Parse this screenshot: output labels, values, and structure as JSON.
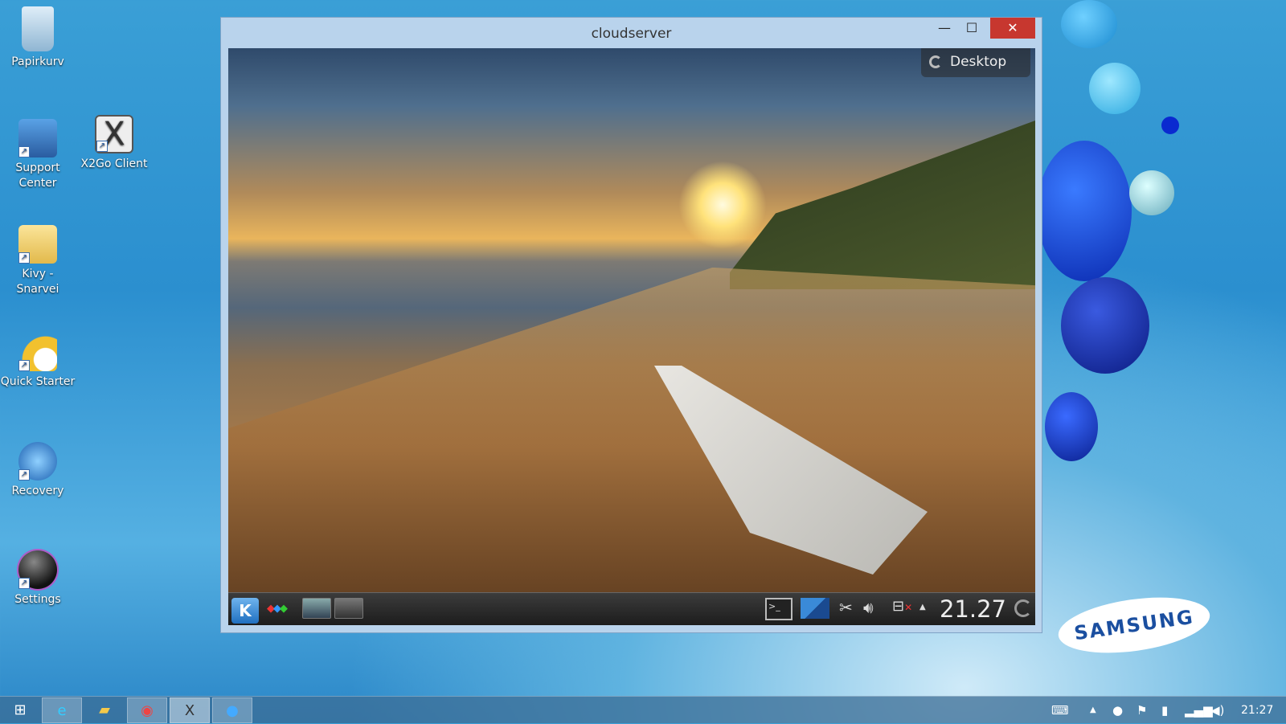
{
  "desktop_icons": [
    {
      "label": "Papirkurv",
      "icon": "recycle-bin-icon"
    },
    {
      "label": "Support Center",
      "icon": "support-center-icon"
    },
    {
      "label": "X2Go Client",
      "icon": "x2go-icon"
    },
    {
      "label": "Kivy - Snarvei",
      "icon": "folder-icon"
    },
    {
      "label": "Quick Starter",
      "icon": "quick-starter-icon"
    },
    {
      "label": "Recovery",
      "icon": "recovery-icon"
    },
    {
      "label": "Settings",
      "icon": "settings-icon"
    }
  ],
  "window": {
    "title": "cloudserver",
    "minimize": "—",
    "maximize": "☐",
    "close": "✕"
  },
  "remote": {
    "desktop_label": "Desktop",
    "panel_clock": "21.27",
    "kmenu": "K"
  },
  "taskbar": {
    "start": "⊞",
    "clock": "21:27",
    "apps": [
      "internet-explorer",
      "file-explorer",
      "chrome",
      "x2go",
      "app"
    ]
  },
  "brand": "SAMSUNG"
}
